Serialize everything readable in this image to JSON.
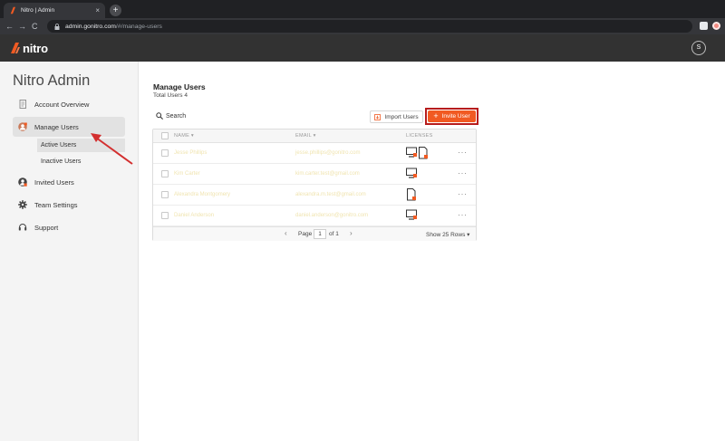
{
  "browser": {
    "tab_title": "Nitro | Admin",
    "tab_close": "×",
    "new_tab": "+",
    "back": "←",
    "forward": "→",
    "reload": "C",
    "url_host": "admin.gonitro.com",
    "url_path": "/#/manage-users"
  },
  "header": {
    "logo_text": "nitro",
    "avatar_initial": "S",
    "brand_color": "#f15a22"
  },
  "sidebar": {
    "title": "Nitro Admin",
    "items": [
      {
        "label": "Account Overview",
        "icon": "document-icon"
      },
      {
        "label": "Manage Users",
        "icon": "users-icon"
      },
      {
        "label": "Invited Users",
        "icon": "invited-user-icon"
      },
      {
        "label": "Team Settings",
        "icon": "gear-icon"
      },
      {
        "label": "Support",
        "icon": "headset-icon"
      }
    ],
    "subitems": [
      {
        "label": "Active Users"
      },
      {
        "label": "Inactive Users"
      }
    ]
  },
  "main": {
    "title": "Manage Users",
    "subtitle": "Total Users 4",
    "search_label": "Search",
    "import_label": "Import Users",
    "invite_label": "Invite User",
    "invite_plus": "+",
    "columns": {
      "name": "NAME",
      "email": "EMAIL",
      "licenses": "LICENSES"
    },
    "rows": [
      {
        "name": "Jesse Phillips",
        "email": "jesse.phillips@gonitro.com",
        "licenses": [
          "desktop",
          "document"
        ]
      },
      {
        "name": "Kim Carter",
        "email": "kim.carter.test@gmail.com",
        "licenses": [
          "desktop"
        ]
      },
      {
        "name": "Alexandra Montgomery",
        "email": "alexandra.m.test@gmail.com",
        "licenses": [
          "document"
        ]
      },
      {
        "name": "Daniel Anderson",
        "email": "daniel.anderson@gonitro.com",
        "licenses": [
          "desktop"
        ]
      }
    ],
    "more_label": "···",
    "pager": {
      "prev": "‹",
      "next": "›",
      "page_label": "Page",
      "page_value": "1",
      "of_label": "of 1",
      "show_rows": "Show 25 Rows ▾"
    }
  }
}
